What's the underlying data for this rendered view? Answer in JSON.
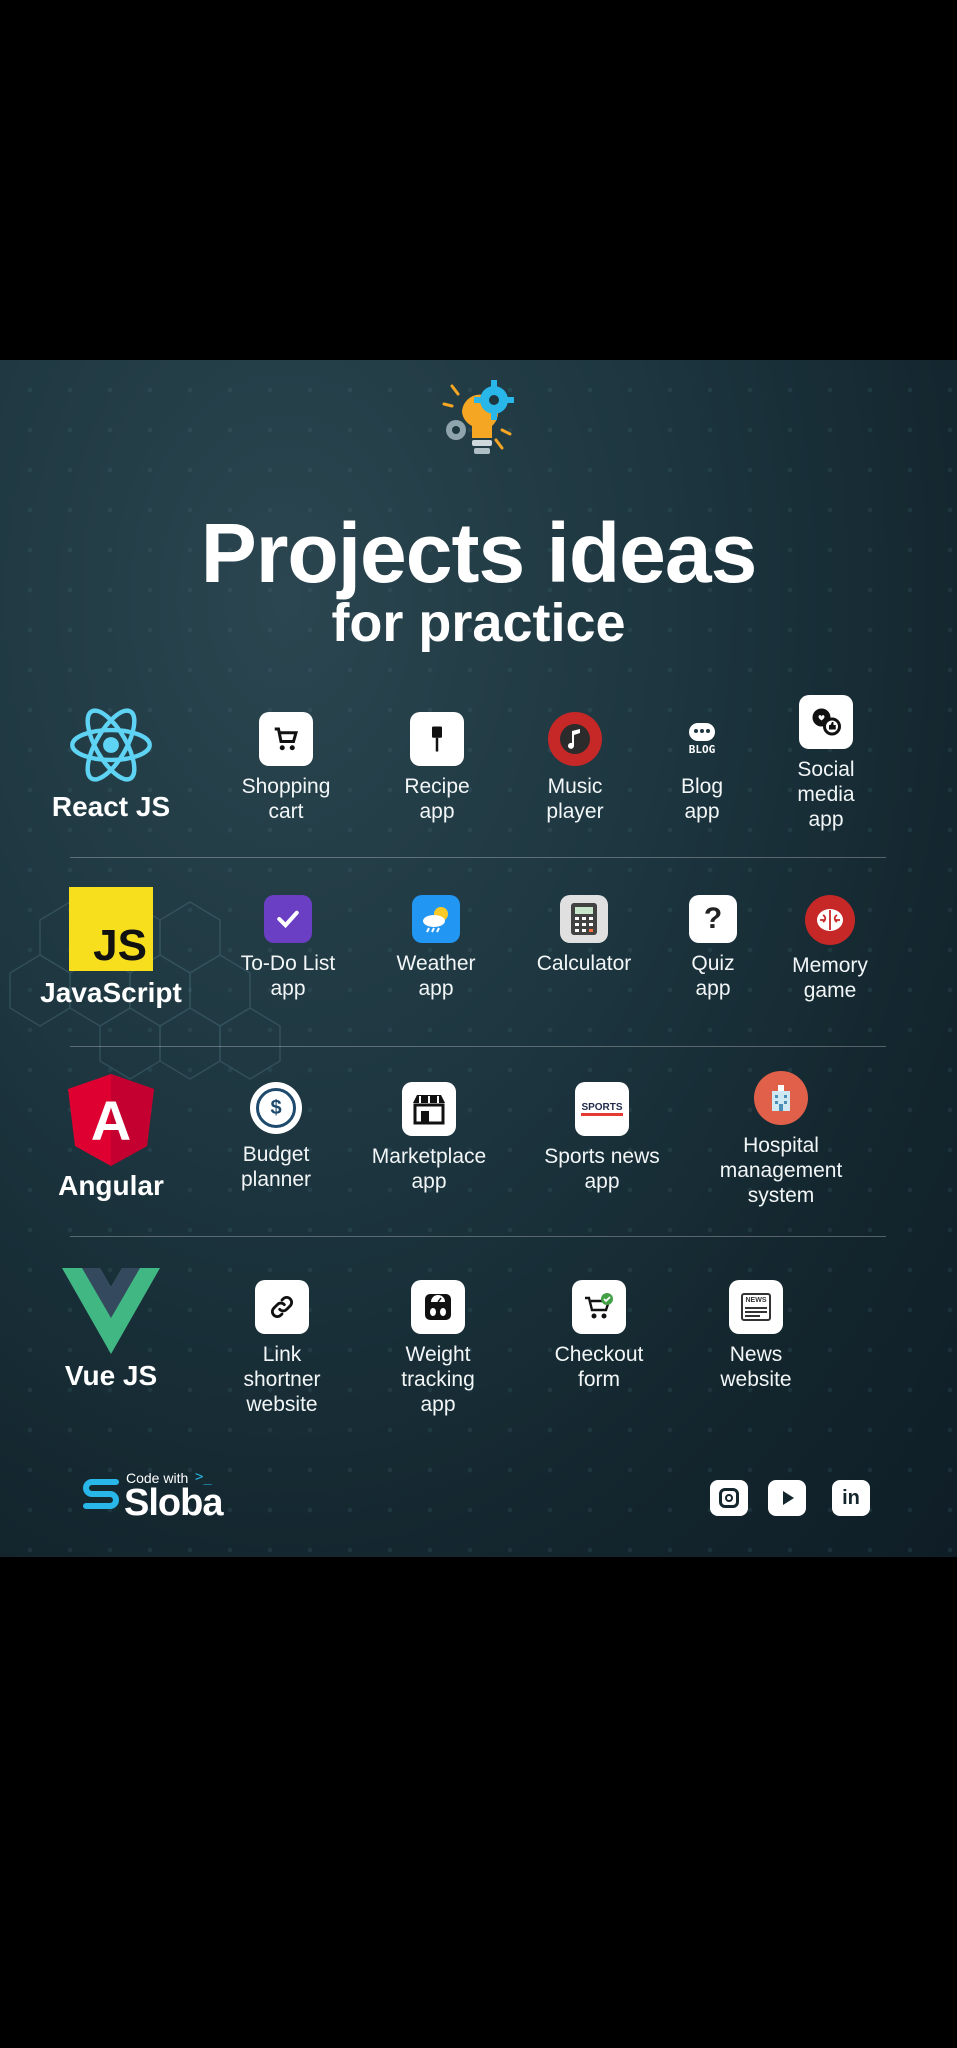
{
  "title": "Projects ideas",
  "subtitle": "for practice",
  "rows": [
    {
      "tech": "React JS",
      "items": [
        {
          "label_lines": [
            "Shopping",
            "cart"
          ],
          "icon": "shopping-cart-icon"
        },
        {
          "label_lines": [
            "Recipe",
            "app"
          ],
          "icon": "spatula-icon"
        },
        {
          "label_lines": [
            "Music",
            "player"
          ],
          "icon": "music-note-icon"
        },
        {
          "label_lines": [
            "Blog",
            "app"
          ],
          "icon": "blog-icon",
          "icon_text": "BLOG"
        },
        {
          "label_lines": [
            "Social",
            "media",
            "app"
          ],
          "icon": "social-chat-icon"
        }
      ]
    },
    {
      "tech": "JavaScript",
      "logo_text": "JS",
      "items": [
        {
          "label_lines": [
            "To-Do List",
            "app"
          ],
          "icon": "checkmark-icon"
        },
        {
          "label_lines": [
            "Weather",
            "app"
          ],
          "icon": "weather-cloud-icon"
        },
        {
          "label_lines": [
            "Calculator"
          ],
          "icon": "calculator-icon"
        },
        {
          "label_lines": [
            "Quiz",
            "app"
          ],
          "icon": "question-mark-icon",
          "icon_text": "?"
        },
        {
          "label_lines": [
            "Memory",
            "game"
          ],
          "icon": "brain-icon"
        }
      ]
    },
    {
      "tech": "Angular",
      "logo_text": "A",
      "items": [
        {
          "label_lines": [
            "Budget",
            "planner"
          ],
          "icon": "budget-dollar-icon",
          "icon_text": "$"
        },
        {
          "label_lines": [
            "Marketplace",
            "app"
          ],
          "icon": "storefront-icon"
        },
        {
          "label_lines": [
            "Sports news",
            "app"
          ],
          "icon": "sports-news-icon",
          "icon_text": "SPORTS"
        },
        {
          "label_lines": [
            "Hospital",
            "management",
            "system"
          ],
          "icon": "hospital-icon"
        }
      ]
    },
    {
      "tech": "Vue JS",
      "items": [
        {
          "label_lines": [
            "Link",
            "shortner",
            "website"
          ],
          "icon": "link-icon"
        },
        {
          "label_lines": [
            "Weight",
            "tracking",
            "app"
          ],
          "icon": "weight-scale-icon"
        },
        {
          "label_lines": [
            "Checkout",
            "form"
          ],
          "icon": "checkout-cart-icon"
        },
        {
          "label_lines": [
            "News",
            "website"
          ],
          "icon": "newspaper-icon",
          "icon_text": "NEWS"
        }
      ]
    }
  ],
  "brand": {
    "small": "Code with",
    "big": "Sloba"
  },
  "social_icons": [
    "instagram-icon",
    "youtube-icon",
    "linkedin-icon"
  ],
  "social_text": {
    "linkedin": "in"
  },
  "colors": {
    "react": "#5ed3f3",
    "js_bg": "#f7df1e",
    "angular": "#dd0031",
    "vue_green": "#41b883",
    "vue_dark": "#35495e",
    "brand": "#29b6e8"
  }
}
